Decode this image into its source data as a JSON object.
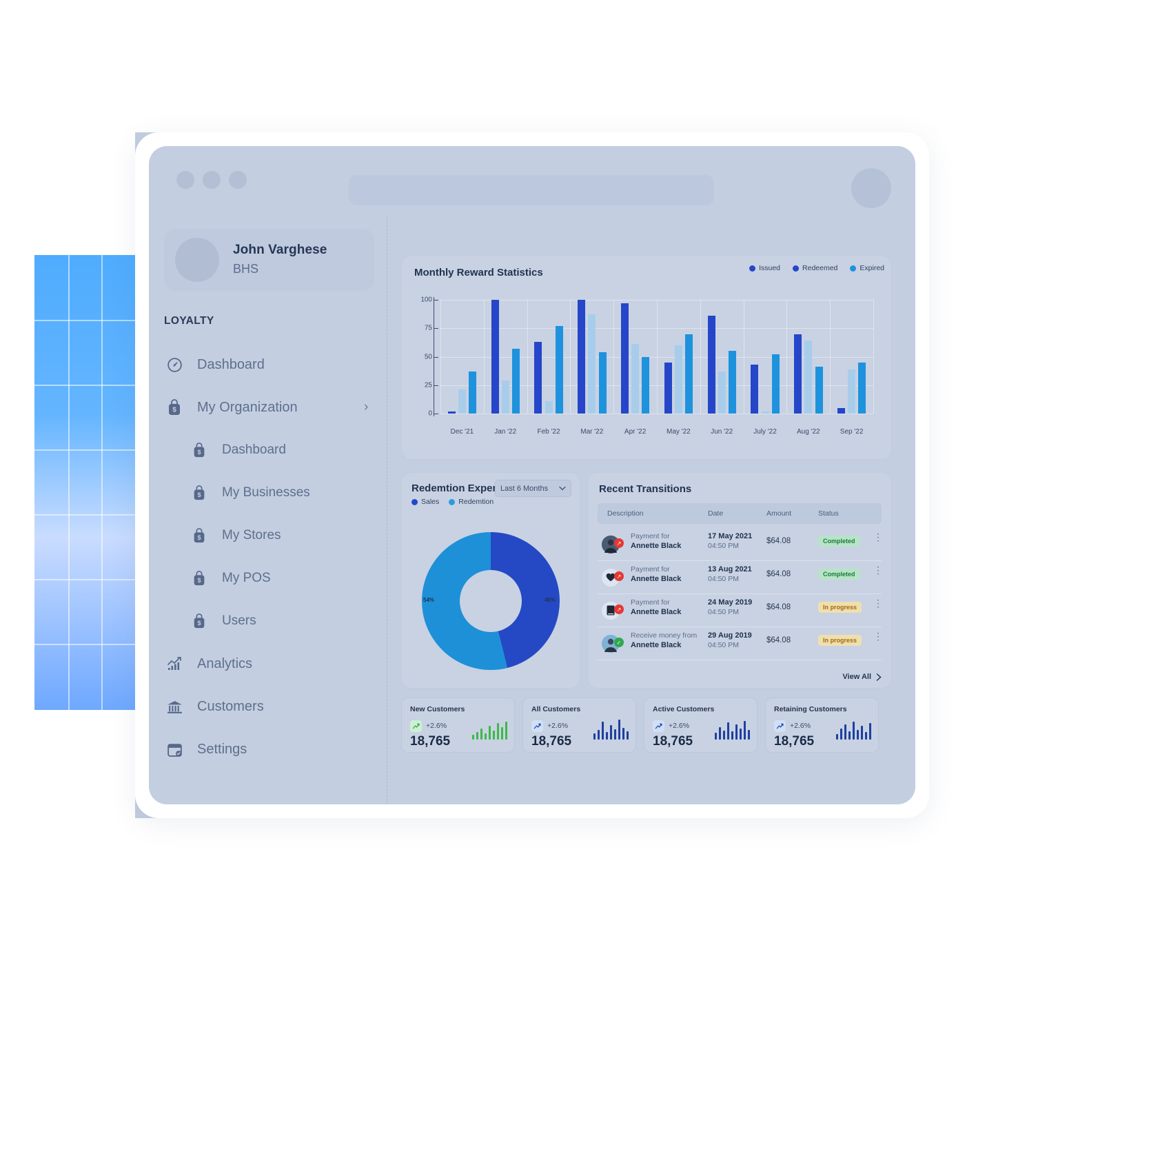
{
  "window": {
    "dots": [
      "close-dot",
      "minimize-dot",
      "maximize-dot"
    ],
    "url_placeholder": ""
  },
  "sidebar": {
    "user": {
      "name": "John Varghese",
      "org": "BHS"
    },
    "section_label": "LOYALTY",
    "items": [
      {
        "label": "Dashboard",
        "icon": "gauge-icon",
        "level": 0,
        "chevron": ""
      },
      {
        "label": "My Organization",
        "icon": "shopping-bag-dollar-icon",
        "level": 0,
        "chevron": "›"
      },
      {
        "label": "Dashboard",
        "icon": "shopping-bag-dollar-icon",
        "level": 1,
        "chevron": ""
      },
      {
        "label": "My Businesses",
        "icon": "shopping-bag-dollar-icon",
        "level": 1,
        "chevron": ""
      },
      {
        "label": "My Stores",
        "icon": "shopping-bag-dollar-icon",
        "level": 1,
        "chevron": ""
      },
      {
        "label": "My POS",
        "icon": "shopping-bag-dollar-icon",
        "level": 1,
        "chevron": ""
      },
      {
        "label": "Users",
        "icon": "shopping-bag-dollar-icon",
        "level": 1,
        "chevron": ""
      },
      {
        "label": "Analytics",
        "icon": "bar-chart-icon",
        "level": 0,
        "chevron": ""
      },
      {
        "label": "Customers",
        "icon": "bank-icon",
        "level": 0,
        "chevron": ""
      },
      {
        "label": "Settings",
        "icon": "calendar-check-icon",
        "level": 0,
        "chevron": ""
      }
    ]
  },
  "chart_data": [
    {
      "type": "bar",
      "title": "Monthly Reward Statistics",
      "categories": [
        "Dec '21",
        "Jan '22",
        "Feb '22",
        "Mar '22",
        "Apr '22",
        "May '22",
        "Jun '22",
        "July '22",
        "Aug '22",
        "Sep '22"
      ],
      "series": [
        {
          "name": "Issued",
          "color": "#2546c8",
          "values": [
            2,
            100,
            63,
            100,
            97,
            45,
            86,
            43,
            70,
            5
          ]
        },
        {
          "name": "Redeemed",
          "color": "#a8cdea",
          "values": [
            21,
            29,
            11,
            87,
            61,
            60,
            37,
            2,
            64,
            39
          ]
        },
        {
          "name": "Expired",
          "color": "#1e92dd",
          "values": [
            37,
            57,
            77,
            54,
            50,
            70,
            55,
            52,
            41,
            45
          ]
        }
      ],
      "ylabel": "",
      "xlabel": "",
      "yticks": [
        0,
        25,
        50,
        75,
        100
      ],
      "ylim": [
        0,
        100
      ],
      "grid": true,
      "legend_position": "top-right"
    },
    {
      "type": "pie",
      "title": "Redemtion Expense",
      "labels": [
        "Sales",
        "Redemtion"
      ],
      "values": [
        46,
        54
      ],
      "value_labels": [
        "46%",
        "54%"
      ],
      "colors": [
        "#2546c8",
        "#1e90d8"
      ],
      "legend": [
        "Sales",
        "Redemtion"
      ],
      "range_filter": "Last 6 Months",
      "donut": true
    }
  ],
  "redemption": {
    "title": "Redemtion Expense",
    "range_label": "Last 6 Months",
    "legend": [
      {
        "label": "Sales",
        "color": "#2546c8"
      },
      {
        "label": "Redemtion",
        "color": "#2e9bd8"
      }
    ],
    "slices": [
      {
        "label": "46%",
        "value": 46
      },
      {
        "label": "54%",
        "value": 54
      }
    ]
  },
  "transitions": {
    "title": "Recent Transitions",
    "columns": [
      "Description",
      "Date",
      "Amount",
      "Status"
    ],
    "rows": [
      {
        "avatar": "photo-avatar-icon",
        "badge": "arrow-up-right-red-icon",
        "desc_top": "Payment for",
        "desc_name": "Annette Black",
        "date": "17 May 2021",
        "time": "04:50 PM",
        "amount": "$64.08",
        "status": "Completed",
        "status_kind": "completed"
      },
      {
        "avatar": "heart-icon",
        "badge": "arrow-up-right-red-icon",
        "desc_top": "Payment for",
        "desc_name": "Annette Black",
        "date": "13 Aug 2021",
        "time": "04:50 PM",
        "amount": "$64.08",
        "status": "Completed",
        "status_kind": "completed"
      },
      {
        "avatar": "book-icon",
        "badge": "arrow-up-right-red-icon",
        "desc_top": "Payment for",
        "desc_name": "Annette Black",
        "date": "24 May 2019",
        "time": "04:50 PM",
        "amount": "$64.08",
        "status": "In progress",
        "status_kind": "progress"
      },
      {
        "avatar": "photo-avatar-icon",
        "badge": "check-green-icon",
        "desc_top": "Receive money from",
        "desc_name": "Annette Black",
        "date": "29 Aug 2019",
        "time": "04:50 PM",
        "amount": "$64.08",
        "status": "In progress",
        "status_kind": "progress"
      }
    ],
    "view_all": "View All"
  },
  "stats": [
    {
      "label": "New Customers",
      "trend": "+2.6%",
      "value": "18,765",
      "spark_color": "#3db84a",
      "spark": [
        7,
        11,
        16,
        9,
        20,
        13,
        24,
        18,
        26
      ]
    },
    {
      "label": "All Customers",
      "trend": "+2.6%",
      "value": "18,765",
      "spark_color": "#1f3f9e",
      "spark": [
        9,
        14,
        26,
        11,
        21,
        15,
        29,
        17,
        12
      ]
    },
    {
      "label": "Active Customers",
      "trend": "+2.6%",
      "value": "18,765",
      "spark_color": "#1f3f9e",
      "spark": [
        10,
        18,
        13,
        25,
        12,
        22,
        16,
        27,
        14
      ]
    },
    {
      "label": "Retaining Customers",
      "trend": "+2.6%",
      "value": "18,765",
      "spark_color": "#1f3f9e",
      "spark": [
        8,
        16,
        22,
        12,
        26,
        14,
        20,
        11,
        24
      ]
    }
  ],
  "colors": {
    "accent_dark_blue": "#2546c8",
    "accent_light_blue": "#1e92dd",
    "accent_pale_blue": "#a8cdea",
    "status_completed_bg": "#b7e4c7",
    "status_completed_fg": "#1f7a3d",
    "status_progress_bg": "#f0dfae",
    "status_progress_fg": "#a06a10"
  }
}
